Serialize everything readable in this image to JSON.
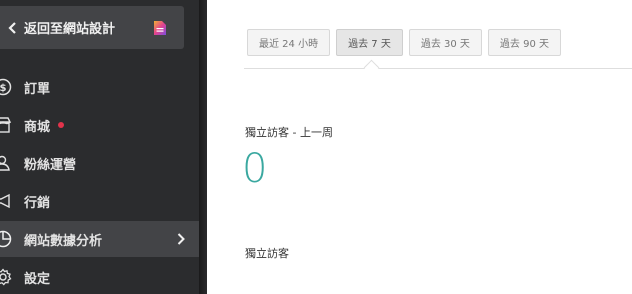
{
  "sidebar": {
    "back_label": "返回至網站設計",
    "items": [
      {
        "label": "訂單",
        "icon": "dollar-circle-icon"
      },
      {
        "label": "商城",
        "icon": "store-icon",
        "has_dot": true,
        "dot_color": "#e2334b"
      },
      {
        "label": "粉絲運營",
        "icon": "users-icon"
      },
      {
        "label": "行銷",
        "icon": "megaphone-icon"
      },
      {
        "label": "網站數據分析",
        "icon": "pie-chart-icon",
        "active": true
      },
      {
        "label": "設定",
        "icon": "gear-icon"
      }
    ]
  },
  "tabs": [
    {
      "label": "最近 24 小時"
    },
    {
      "label": "過去 7 天",
      "active": true
    },
    {
      "label": "過去 30 天"
    },
    {
      "label": "過去 90 天"
    }
  ],
  "stats": {
    "unique_visitors_last_week_title": "獨立訪客 - 上一周",
    "unique_visitors_last_week_value": "0",
    "unique_visitors_title": "獨立訪客"
  },
  "colors": {
    "sidebar_bg": "#2b2c2e",
    "active_bg": "#434447",
    "accent_teal": "#3aa8a0",
    "dot_red": "#e2334b"
  }
}
